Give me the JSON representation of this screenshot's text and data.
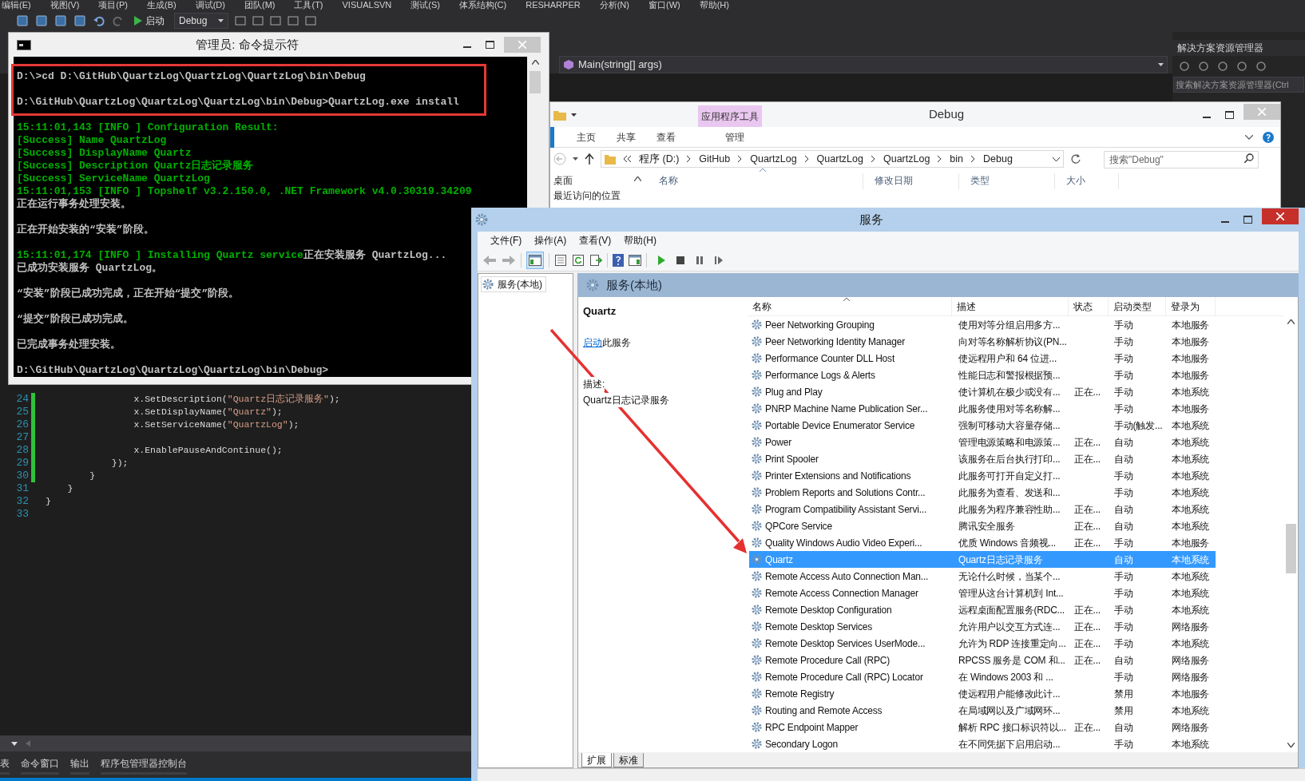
{
  "ide": {
    "menu": [
      "编辑(E)",
      "视图(V)",
      "项目(P)",
      "生成(B)",
      "调试(D)",
      "团队(M)",
      "工具(T)",
      "VISUALSVN",
      "测试(S)",
      "体系结构(C)",
      "RESHARPER",
      "分析(N)",
      "窗口(W)",
      "帮助(H)"
    ],
    "start_button": "启动",
    "configuration": "Debug",
    "navigation_bar": "Main(string[] args)",
    "solution_explorer": {
      "title": "解决方案资源管理器",
      "search_placeholder": "搜索解决方案资源管理器(Ctrl"
    },
    "code_lines": [
      {
        "number": "24",
        "changed": true,
        "segments": [
          {
            "text": "                x.SetDescription(",
            "kind": "plain"
          },
          {
            "text": "\"Quartz日志记录服务\"",
            "kind": "string"
          },
          {
            "text": ");",
            "kind": "plain"
          }
        ]
      },
      {
        "number": "25",
        "changed": true,
        "segments": [
          {
            "text": "                x.SetDisplayName(",
            "kind": "plain"
          },
          {
            "text": "\"Quartz\"",
            "kind": "string"
          },
          {
            "text": ");",
            "kind": "plain"
          }
        ]
      },
      {
        "number": "26",
        "changed": true,
        "segments": [
          {
            "text": "                x.SetServiceName(",
            "kind": "plain"
          },
          {
            "text": "\"QuartzLog\"",
            "kind": "string"
          },
          {
            "text": ");",
            "kind": "plain"
          }
        ]
      },
      {
        "number": "27",
        "changed": true
      },
      {
        "number": "28",
        "changed": true,
        "segments": [
          {
            "text": "                x.EnablePauseAndContinue();",
            "kind": "plain"
          }
        ]
      },
      {
        "number": "29",
        "changed": true,
        "segments": [
          {
            "text": "            });",
            "kind": "plain"
          }
        ]
      },
      {
        "number": "30",
        "changed": true,
        "segments": [
          {
            "text": "        }",
            "kind": "plain"
          }
        ]
      },
      {
        "number": "31",
        "changed": false,
        "segments": [
          {
            "text": "    }",
            "kind": "plain"
          }
        ]
      },
      {
        "number": "32",
        "changed": false,
        "segments": [
          {
            "text": "}",
            "kind": "plain"
          }
        ]
      },
      {
        "number": "33",
        "changed": false
      }
    ],
    "bottom_tabs": [
      "表",
      "命令窗口",
      "输出",
      "程序包管理器控制台"
    ]
  },
  "console": {
    "title": "管理员: 命令提示符",
    "blocks": [
      {
        "highlighted": true,
        "lines": [
          [
            {
              "text": "D:\\>cd D:\\GitHub\\QuartzLog\\QuartzLog\\QuartzLog\\bin\\Debug",
              "color": "#c0c0c0"
            }
          ]
        ]
      },
      {
        "highlighted": true,
        "lines": [
          [
            {
              "text": "D:\\GitHub\\QuartzLog\\QuartzLog\\QuartzLog\\bin\\Debug>QuartzLog.exe install",
              "color": "#c0c0c0"
            }
          ]
        ]
      },
      {
        "highlighted": false,
        "lines": [
          [
            {
              "text": "15:11:01,143 [INFO ] Configuration Result:",
              "color": "#00b000"
            }
          ],
          [
            {
              "text": "[Success] Name QuartzLog",
              "color": "#00b000"
            }
          ],
          [
            {
              "text": "[Success] DisplayName Quartz",
              "color": "#00b000"
            }
          ],
          [
            {
              "text": "[Success] Description Quartz日志记录服务",
              "color": "#00b000"
            }
          ],
          [
            {
              "text": "[Success] ServiceName QuartzLog",
              "color": "#00b000"
            }
          ],
          [
            {
              "text": "15:11:01,153 [INFO ] Topshelf v3.2.150.0, .NET Framework v4.0.30319.34209",
              "color": "#00b000"
            }
          ],
          [
            {
              "text": "正在运行事务处理安装。",
              "color": "#c0c0c0"
            }
          ]
        ]
      },
      {
        "highlighted": false,
        "lines": [
          [
            {
              "text": "正在开始安装的“安装”阶段。",
              "color": "#c0c0c0"
            }
          ]
        ]
      },
      {
        "highlighted": false,
        "lines": [
          [
            {
              "text": "15:11:01,174 [INFO ] Installing Quartz service",
              "color": "#00b000"
            },
            {
              "text": "正在安装服务 QuartzLog...",
              "color": "#c0c0c0"
            }
          ],
          [
            {
              "text": "已成功安装服务 QuartzLog。",
              "color": "#c0c0c0"
            }
          ]
        ]
      },
      {
        "highlighted": false,
        "lines": [
          [
            {
              "text": "“安装”阶段已成功完成，正在开始“提交”阶段。",
              "color": "#c0c0c0"
            }
          ]
        ]
      },
      {
        "highlighted": false,
        "lines": [
          [
            {
              "text": "“提交”阶段已成功完成。",
              "color": "#c0c0c0"
            }
          ]
        ]
      },
      {
        "highlighted": false,
        "lines": [
          [
            {
              "text": "已完成事务处理安装。",
              "color": "#c0c0c0"
            }
          ]
        ]
      },
      {
        "highlighted": false,
        "lines": [
          [
            {
              "text": "D:\\GitHub\\QuartzLog\\QuartzLog\\QuartzLog\\bin\\Debug>",
              "color": "#c0c0c0"
            }
          ]
        ]
      }
    ]
  },
  "explorer": {
    "title": "Debug",
    "context_tab": "应用程序工具",
    "tabs": [
      {
        "label": "主页",
        "selected": false
      },
      {
        "label": "共享",
        "selected": false
      },
      {
        "label": "查看",
        "selected": false
      },
      {
        "label": "管理",
        "selected": false
      }
    ],
    "path": [
      "程序 (D:)",
      "GitHub",
      "QuartzLog",
      "QuartzLog",
      "QuartzLog",
      "bin",
      "Debug"
    ],
    "search_placeholder": "搜索\"Debug\"",
    "nav_items": [
      "桌面",
      "最近访问的位置"
    ],
    "columns": [
      "名称",
      "修改日期",
      "类型",
      "大小"
    ]
  },
  "services": {
    "title": "服务",
    "menu": [
      "文件(F)",
      "操作(A)",
      "查看(V)",
      "帮助(H)"
    ],
    "tree_item": "服务(本地)",
    "pane_title": "服务(本地)",
    "detail": {
      "name": "Quartz",
      "action_link": "启动",
      "action_text": "此服务",
      "description_label": "描述:",
      "description": "Quartz日志记录服务"
    },
    "columns": [
      "名称",
      "描述",
      "状态",
      "启动类型",
      "登录为"
    ],
    "rows": [
      {
        "name": "Peer Networking Grouping",
        "description": "使用对等分组启用多方...",
        "status": "",
        "startup": "手动",
        "logon": "本地服务",
        "selected": false
      },
      {
        "name": "Peer Networking Identity Manager",
        "description": "向对等名称解析协议(PN...",
        "status": "",
        "startup": "手动",
        "logon": "本地服务",
        "selected": false
      },
      {
        "name": "Performance Counter DLL Host",
        "description": "使远程用户和 64 位进...",
        "status": "",
        "startup": "手动",
        "logon": "本地服务",
        "selected": false
      },
      {
        "name": "Performance Logs & Alerts",
        "description": "性能日志和警报根据预...",
        "status": "",
        "startup": "手动",
        "logon": "本地服务",
        "selected": false
      },
      {
        "name": "Plug and Play",
        "description": "使计算机在极少或没有...",
        "status": "正在...",
        "startup": "手动",
        "logon": "本地系统",
        "selected": false
      },
      {
        "name": "PNRP Machine Name Publication Ser...",
        "description": "此服务使用对等名称解...",
        "status": "",
        "startup": "手动",
        "logon": "本地服务",
        "selected": false
      },
      {
        "name": "Portable Device Enumerator Service",
        "description": "强制可移动大容量存储...",
        "status": "",
        "startup": "手动(触发...",
        "logon": "本地系统",
        "selected": false
      },
      {
        "name": "Power",
        "description": "管理电源策略和电源策...",
        "status": "正在...",
        "startup": "自动",
        "logon": "本地系统",
        "selected": false
      },
      {
        "name": "Print Spooler",
        "description": "该服务在后台执行打印...",
        "status": "正在...",
        "startup": "自动",
        "logon": "本地系统",
        "selected": false
      },
      {
        "name": "Printer Extensions and Notifications",
        "description": "此服务可打开自定义打...",
        "status": "",
        "startup": "手动",
        "logon": "本地系统",
        "selected": false
      },
      {
        "name": "Problem Reports and Solutions Contr...",
        "description": "此服务为查看、发送和...",
        "status": "",
        "startup": "手动",
        "logon": "本地系统",
        "selected": false
      },
      {
        "name": "Program Compatibility Assistant Servi...",
        "description": "此服务为程序兼容性助...",
        "status": "正在...",
        "startup": "自动",
        "logon": "本地系统",
        "selected": false
      },
      {
        "name": "QPCore Service",
        "description": "腾讯安全服务",
        "status": "正在...",
        "startup": "自动",
        "logon": "本地系统",
        "selected": false
      },
      {
        "name": "Quality Windows Audio Video Experi...",
        "description": "优质 Windows 音频视...",
        "status": "正在...",
        "startup": "手动",
        "logon": "本地服务",
        "selected": false
      },
      {
        "name": "Quartz",
        "description": "Quartz日志记录服务",
        "status": "",
        "startup": "自动",
        "logon": "本地系统",
        "selected": true
      },
      {
        "name": "Remote Access Auto Connection Man...",
        "description": "无论什么时候，当某个...",
        "status": "",
        "startup": "手动",
        "logon": "本地系统",
        "selected": false
      },
      {
        "name": "Remote Access Connection Manager",
        "description": "管理从这台计算机到 Int...",
        "status": "",
        "startup": "手动",
        "logon": "本地系统",
        "selected": false
      },
      {
        "name": "Remote Desktop Configuration",
        "description": "远程桌面配置服务(RDC...",
        "status": "正在...",
        "startup": "手动",
        "logon": "本地系统",
        "selected": false
      },
      {
        "name": "Remote Desktop Services",
        "description": "允许用户以交互方式连...",
        "status": "正在...",
        "startup": "手动",
        "logon": "网络服务",
        "selected": false
      },
      {
        "name": "Remote Desktop Services UserMode...",
        "description": "允许为 RDP 连接重定向...",
        "status": "正在...",
        "startup": "手动",
        "logon": "本地系统",
        "selected": false
      },
      {
        "name": "Remote Procedure Call (RPC)",
        "description": "RPCSS 服务是 COM 和...",
        "status": "正在...",
        "startup": "自动",
        "logon": "网络服务",
        "selected": false
      },
      {
        "name": "Remote Procedure Call (RPC) Locator",
        "description": "在 Windows 2003 和 ...",
        "status": "",
        "startup": "手动",
        "logon": "网络服务",
        "selected": false
      },
      {
        "name": "Remote Registry",
        "description": "使远程用户能修改此计...",
        "status": "",
        "startup": "禁用",
        "logon": "本地服务",
        "selected": false
      },
      {
        "name": "Routing and Remote Access",
        "description": "在局域网以及广域网环...",
        "status": "",
        "startup": "禁用",
        "logon": "本地系统",
        "selected": false
      },
      {
        "name": "RPC Endpoint Mapper",
        "description": "解析 RPC 接口标识符以...",
        "status": "正在...",
        "startup": "自动",
        "logon": "网络服务",
        "selected": false
      },
      {
        "name": "Secondary Logon",
        "description": "在不同凭据下启用启动...",
        "status": "",
        "startup": "手动",
        "logon": "本地系统",
        "selected": false
      }
    ],
    "view_tabs": [
      {
        "label": "扩展",
        "selected": true
      },
      {
        "label": "标准",
        "selected": false
      }
    ]
  }
}
